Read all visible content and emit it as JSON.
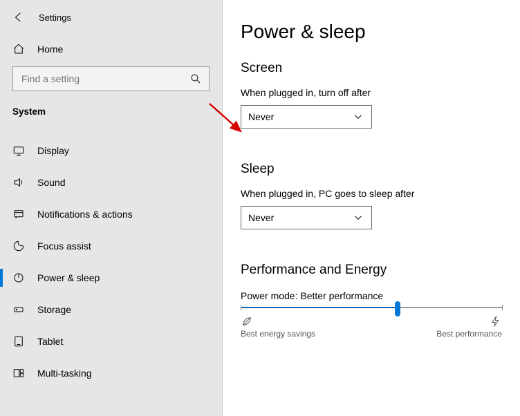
{
  "header": {
    "app_title": "Settings"
  },
  "sidebar": {
    "home_label": "Home",
    "search_placeholder": "Find a setting",
    "category": "System",
    "items": [
      {
        "label": "Display"
      },
      {
        "label": "Sound"
      },
      {
        "label": "Notifications & actions"
      },
      {
        "label": "Focus assist"
      },
      {
        "label": "Power & sleep"
      },
      {
        "label": "Storage"
      },
      {
        "label": "Tablet"
      },
      {
        "label": "Multi-tasking"
      }
    ]
  },
  "main": {
    "title": "Power & sleep",
    "screen": {
      "heading": "Screen",
      "label": "When plugged in, turn off after",
      "value": "Never"
    },
    "sleep": {
      "heading": "Sleep",
      "label": "When plugged in, PC goes to sleep after",
      "value": "Never"
    },
    "perf": {
      "heading": "Performance and Energy",
      "mode_prefix": "Power mode: ",
      "mode_value": "Better performance",
      "left_cap": "Best energy savings",
      "right_cap": "Best performance"
    }
  }
}
